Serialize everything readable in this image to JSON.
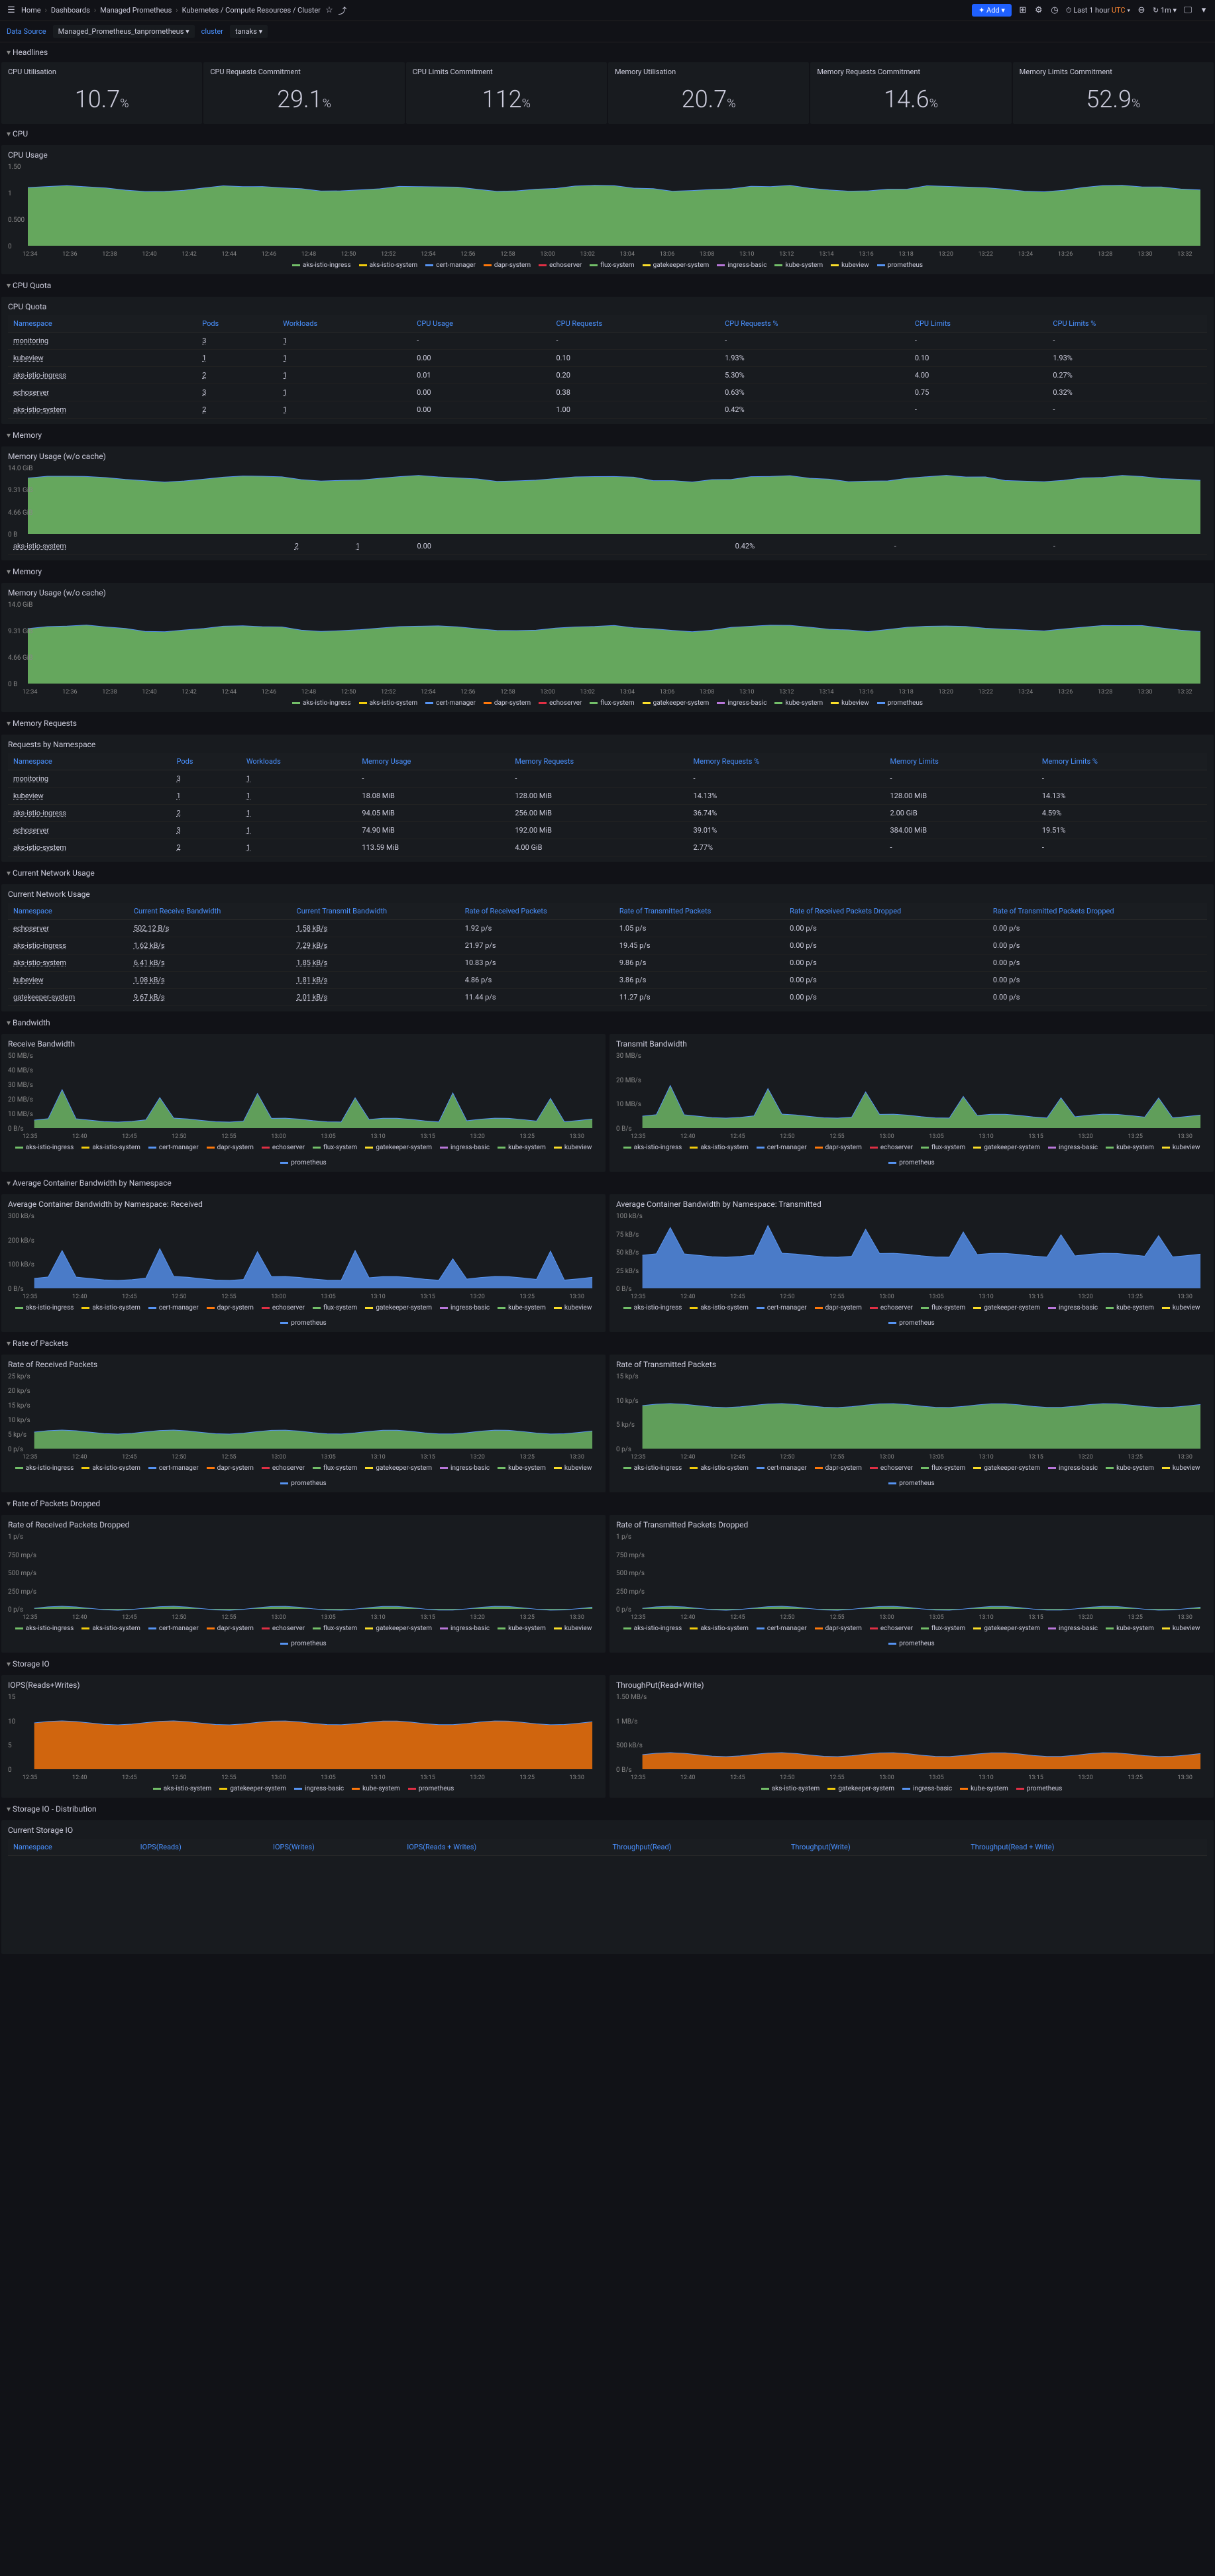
{
  "topbar": {
    "home": "Home",
    "dashboards": "Dashboards",
    "managed": "Managed Prometheus",
    "page": "Kubernetes / Compute Resources / Cluster",
    "add": "Add",
    "timerange": "Last 1 hour",
    "utc": "UTC",
    "refresh": "1m"
  },
  "filters": {
    "ds_label": "Data Source",
    "ds_value": "Managed_Prometheus_tanprometheus",
    "cluster_label": "cluster",
    "cluster_value": "tanaks"
  },
  "sections": {
    "headlines": "Headlines",
    "cpu": "CPU",
    "cpu_quota": "CPU Quota",
    "memory": "Memory",
    "memory2": "Memory",
    "memory_requests": "Memory Requests",
    "network": "Current Network Usage",
    "bandwidth": "Bandwidth",
    "avg_bw": "Average Container Bandwidth by Namespace",
    "rate_packets": "Rate of Packets",
    "rate_dropped": "Rate of Packets Dropped",
    "storage": "Storage IO",
    "storage_dist": "Storage IO - Distribution"
  },
  "headlines": [
    {
      "title": "CPU Utilisation",
      "value": "10.7",
      "unit": "%"
    },
    {
      "title": "CPU Requests Commitment",
      "value": "29.1",
      "unit": "%"
    },
    {
      "title": "CPU Limits Commitment",
      "value": "112",
      "unit": "%"
    },
    {
      "title": "Memory Utilisation",
      "value": "20.7",
      "unit": "%"
    },
    {
      "title": "Memory Requests Commitment",
      "value": "14.6",
      "unit": "%"
    },
    {
      "title": "Memory Limits Commitment",
      "value": "52.9",
      "unit": "%"
    }
  ],
  "cpu_usage": {
    "title": "CPU Usage",
    "ylabels": [
      "1.50",
      "1",
      "0.500",
      "0"
    ]
  },
  "timeticks": [
    "12:34",
    "12:36",
    "12:38",
    "12:40",
    "12:42",
    "12:44",
    "12:46",
    "12:48",
    "12:50",
    "12:52",
    "12:54",
    "12:56",
    "12:58",
    "13:00",
    "13:02",
    "13:04",
    "13:06",
    "13:08",
    "13:10",
    "13:12",
    "13:14",
    "13:16",
    "13:18",
    "13:20",
    "13:22",
    "13:24",
    "13:26",
    "13:28",
    "13:30",
    "13:32"
  ],
  "timeticks_sm": [
    "12:35",
    "12:40",
    "12:45",
    "12:50",
    "12:55",
    "13:00",
    "13:05",
    "13:10",
    "13:15",
    "13:20",
    "13:25",
    "13:30"
  ],
  "legend_full": [
    {
      "name": "aks-istio-ingress",
      "color": "#73bf69"
    },
    {
      "name": "aks-istio-system",
      "color": "#f2cc0c"
    },
    {
      "name": "cert-manager",
      "color": "#5794f2"
    },
    {
      "name": "dapr-system",
      "color": "#ff780a"
    },
    {
      "name": "echoserver",
      "color": "#e02f44"
    },
    {
      "name": "flux-system",
      "color": "#73bf69"
    },
    {
      "name": "gatekeeper-system",
      "color": "#fade2a"
    },
    {
      "name": "ingress-basic",
      "color": "#b877d9"
    },
    {
      "name": "kube-system",
      "color": "#73bf69"
    },
    {
      "name": "kubeview",
      "color": "#fade2a"
    },
    {
      "name": "prometheus",
      "color": "#5794f2"
    }
  ],
  "cpu_quota": {
    "title": "CPU Quota",
    "headers": [
      "Namespace",
      "Pods",
      "Workloads",
      "CPU Usage",
      "CPU Requests",
      "CPU Requests %",
      "CPU Limits",
      "CPU Limits %"
    ],
    "rows": [
      [
        "monitoring",
        "3",
        "1",
        "-",
        "-",
        "-",
        "-",
        "-"
      ],
      [
        "kubeview",
        "1",
        "1",
        "0.00",
        "0.10",
        "1.93%",
        "0.10",
        "1.93%"
      ],
      [
        "aks-istio-ingress",
        "2",
        "1",
        "0.01",
        "0.20",
        "5.30%",
        "4.00",
        "0.27%"
      ],
      [
        "echoserver",
        "3",
        "1",
        "0.00",
        "0.38",
        "0.63%",
        "0.75",
        "0.32%"
      ],
      [
        "aks-istio-system",
        "2",
        "1",
        "0.00",
        "1.00",
        "0.42%",
        "-",
        "-"
      ]
    ]
  },
  "mem_usage": {
    "title": "Memory Usage (w/o cache)",
    "ylabels": [
      "14.0 GiB",
      "9.31 GiB",
      "4.66 GiB",
      "0 B"
    ]
  },
  "mem_extra_row": [
    "aks-istio-system",
    "2",
    "1",
    "0.00",
    "",
    "0.42%",
    "-",
    "-"
  ],
  "mem_requests": {
    "title": "Requests by Namespace",
    "headers": [
      "Namespace",
      "Pods",
      "Workloads",
      "Memory Usage",
      "Memory Requests",
      "Memory Requests %",
      "Memory Limits",
      "Memory Limits %"
    ],
    "rows": [
      [
        "monitoring",
        "3",
        "1",
        "-",
        "-",
        "-",
        "-",
        "-"
      ],
      [
        "kubeview",
        "1",
        "1",
        "18.08 MiB",
        "128.00 MiB",
        "14.13%",
        "128.00 MiB",
        "14.13%"
      ],
      [
        "aks-istio-ingress",
        "2",
        "1",
        "94.05 MiB",
        "256.00 MiB",
        "36.74%",
        "2.00 GiB",
        "4.59%"
      ],
      [
        "echoserver",
        "3",
        "1",
        "74.90 MiB",
        "192.00 MiB",
        "39.01%",
        "384.00 MiB",
        "19.51%"
      ],
      [
        "aks-istio-system",
        "2",
        "1",
        "113.59 MiB",
        "4.00 GiB",
        "2.77%",
        "-",
        "-"
      ]
    ]
  },
  "network": {
    "title": "Current Network Usage",
    "headers": [
      "Namespace",
      "Current Receive Bandwidth",
      "Current Transmit Bandwidth",
      "Rate of Received Packets",
      "Rate of Transmitted Packets",
      "Rate of Received Packets Dropped",
      "Rate of Transmitted Packets Dropped"
    ],
    "rows": [
      [
        "echoserver",
        "502.12 B/s",
        "1.58 kB/s",
        "1.92 p/s",
        "1.05 p/s",
        "0.00 p/s",
        "0.00 p/s"
      ],
      [
        "aks-istio-ingress",
        "1.62 kB/s",
        "7.29 kB/s",
        "21.97 p/s",
        "19.45 p/s",
        "0.00 p/s",
        "0.00 p/s"
      ],
      [
        "aks-istio-system",
        "6.41 kB/s",
        "1.85 kB/s",
        "10.83 p/s",
        "9.86 p/s",
        "0.00 p/s",
        "0.00 p/s"
      ],
      [
        "kubeview",
        "1.08 kB/s",
        "1.81 kB/s",
        "4.86 p/s",
        "3.86 p/s",
        "0.00 p/s",
        "0.00 p/s"
      ],
      [
        "gatekeeper-system",
        "9.67 kB/s",
        "2.01 kB/s",
        "11.44 p/s",
        "11.27 p/s",
        "0.00 p/s",
        "0.00 p/s"
      ]
    ]
  },
  "panels": {
    "rx": "Receive Bandwidth",
    "tx": "Transmit Bandwidth",
    "avg_rx": "Average Container Bandwidth by Namespace: Received",
    "avg_tx": "Average Container Bandwidth by Namespace: Transmitted",
    "pkt_rx": "Rate of Received Packets",
    "pkt_tx": "Rate of Transmitted Packets",
    "drop_rx": "Rate of Received Packets Dropped",
    "drop_tx": "Rate of Transmitted Packets Dropped",
    "iops": "IOPS(Reads+Writes)",
    "tput": "ThroughPut(Read+Write)"
  },
  "ylabels": {
    "rx": [
      "50 MB/s",
      "40 MB/s",
      "30 MB/s",
      "20 MB/s",
      "10 MB/s",
      "0 B/s"
    ],
    "tx": [
      "30 MB/s",
      "20 MB/s",
      "10 MB/s",
      "0 B/s"
    ],
    "avg_rx": [
      "300 kB/s",
      "200 kB/s",
      "100 kB/s",
      "0 B/s"
    ],
    "avg_tx": [
      "100 kB/s",
      "75 kB/s",
      "50 kB/s",
      "25 kB/s",
      "0 B/s"
    ],
    "pkt_rx": [
      "25 kp/s",
      "20 kp/s",
      "15 kp/s",
      "10 kp/s",
      "5 kp/s",
      "0 p/s"
    ],
    "pkt_tx": [
      "15 kp/s",
      "10 kp/s",
      "5 kp/s",
      "0 p/s"
    ],
    "drop": [
      "1 p/s",
      "750 mp/s",
      "500 mp/s",
      "250 mp/s",
      "0 p/s"
    ],
    "iops": [
      "15",
      "10",
      "5",
      "0"
    ],
    "tput": [
      "1.50 MB/s",
      "1 MB/s",
      "500 kB/s",
      "0 B/s"
    ]
  },
  "legend_storage": [
    {
      "name": "aks-istio-system",
      "color": "#73bf69"
    },
    {
      "name": "gatekeeper-system",
      "color": "#f2cc0c"
    },
    {
      "name": "ingress-basic",
      "color": "#5794f2"
    },
    {
      "name": "kube-system",
      "color": "#ff780a"
    },
    {
      "name": "prometheus",
      "color": "#e02f44"
    }
  ],
  "storage_dist": {
    "title": "Current Storage IO",
    "headers": [
      "Namespace",
      "IOPS(Reads)",
      "IOPS(Writes)",
      "IOPS(Reads + Writes)",
      "Throughput(Read)",
      "Throughput(Write)",
      "Throughput(Read + Write)"
    ]
  },
  "chart_data": {
    "cpu_usage": {
      "type": "area",
      "x": "timeticks",
      "ylim": [
        0,
        1.5
      ],
      "series": [
        {
          "name": "total-stack",
          "approx": 1.0
        }
      ]
    },
    "mem_usage": {
      "type": "area",
      "x": "timeticks",
      "ylim": [
        0,
        14
      ],
      "unit": "GiB",
      "series": [
        {
          "name": "total-stack",
          "approx": 9.0
        }
      ]
    },
    "rx": {
      "type": "area",
      "ylim": [
        0,
        50
      ],
      "unit": "MB/s"
    },
    "tx": {
      "type": "area",
      "ylim": [
        0,
        30
      ],
      "unit": "MB/s"
    },
    "iops": {
      "type": "area",
      "ylim": [
        0,
        15
      ],
      "fill": "#ff780a"
    },
    "tput": {
      "type": "area",
      "ylim": [
        0,
        1.5
      ],
      "unit": "MB/s"
    }
  }
}
